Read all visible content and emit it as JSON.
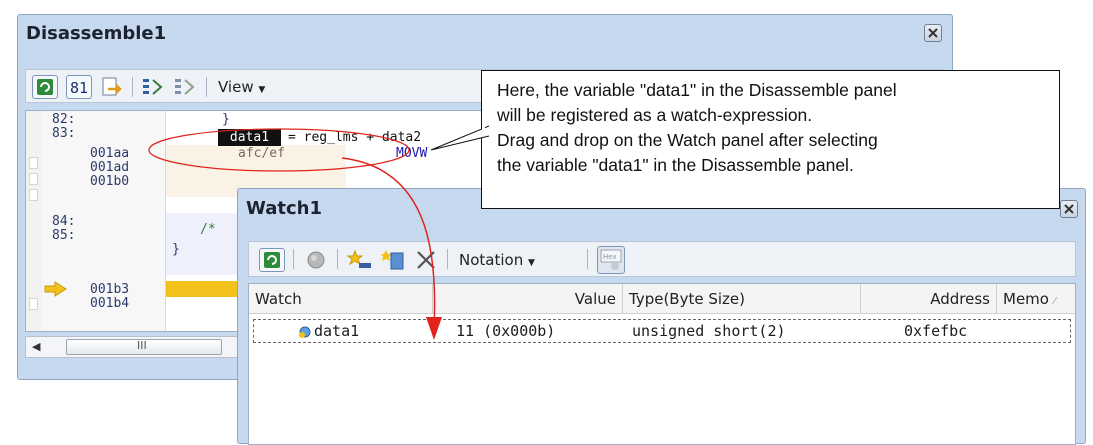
{
  "disassemble": {
    "title": "Disassemble1",
    "toolbar": {
      "view_label": "View"
    },
    "lines": [
      {
        "addr": "82:",
        "code": "}"
      },
      {
        "addr": "83:",
        "code": "= reg_lms + data2"
      },
      {
        "addr": "001aa",
        "code": "afc/ef",
        "mnemonic": "MOVW"
      },
      {
        "addr": "001ad",
        "code": ""
      },
      {
        "addr": "001b0",
        "code": ""
      },
      {
        "addr": "84:",
        "code": "/*"
      },
      {
        "addr": "85:",
        "code": "}"
      },
      {
        "addr": "001b3",
        "code": ""
      },
      {
        "addr": "001b4",
        "code": ""
      }
    ],
    "selected_variable": "data1",
    "scrollbar_grip": "III"
  },
  "watch": {
    "title": "Watch1",
    "toolbar": {
      "notation_label": "Notation"
    },
    "columns": {
      "watch": "Watch",
      "value": "Value",
      "type": "Type(Byte Size)",
      "address": "Address",
      "memo": "Memo"
    },
    "rows": [
      {
        "watch": "data1",
        "value": "11 (0x000b)",
        "type": "unsigned short(2)",
        "address": "0xfefbc"
      }
    ]
  },
  "callout": {
    "lines": [
      "Here, the variable \"data1\" in the Disassemble panel",
      "will be registered as a watch-expression.",
      "Drag and drop on the Watch panel after selecting",
      "the variable \"data1\" in the Disassemble panel."
    ]
  },
  "colors": {
    "window_frame": "#c7d9ee",
    "pc_marker": "#f2c21a",
    "drag_arrow": "#e0231b",
    "refresh_icon": "#2e8b3a"
  }
}
